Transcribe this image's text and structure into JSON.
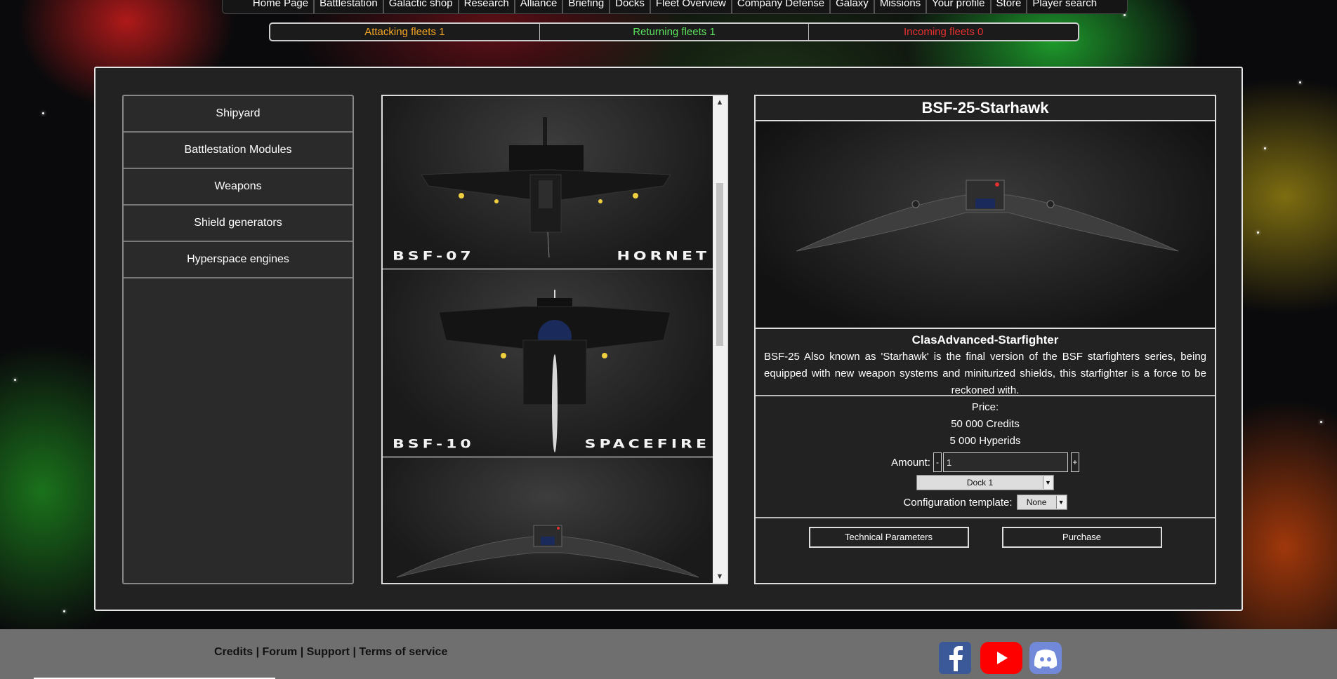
{
  "nav": {
    "items": [
      "Home Page",
      "Battlestation",
      "Galactic shop",
      "Research",
      "Alliance",
      "Briefing",
      "Docks",
      "Fleet Overview",
      "Company Defense",
      "Galaxy",
      "Missions",
      "Your profile",
      "Store",
      "Player search"
    ]
  },
  "fleets": {
    "attacking": "Attacking fleets 1",
    "returning": "Returning fleets 1",
    "incoming": "Incoming fleets 0",
    "colors": {
      "attacking": "#f5a623",
      "returning": "#5be35b",
      "incoming": "#e8312f"
    }
  },
  "menu": {
    "items": [
      "Shipyard",
      "Battlestation Modules",
      "Weapons",
      "Shield generators",
      "Hyperspace engines"
    ]
  },
  "ships": [
    {
      "code": "BSF-07",
      "name": "HORNET"
    },
    {
      "code": "BSF-10",
      "name": "SPACEFIRE"
    },
    {
      "code": "",
      "name": ""
    }
  ],
  "detail": {
    "title": "BSF-25-Starhawk",
    "class": "ClasAdvanced-Starfighter",
    "description": "BSF-25 Also known as 'Starhawk' is the final version of the BSF starfighters series, being equipped with new weapon systems and miniturized shields, this starfighter is a force to be reckoned with.",
    "price_label": "Price:",
    "price_credits": "50 000 Credits",
    "price_hyperids": "5 000 Hyperids",
    "amount_label": "Amount:",
    "amount_value": "1",
    "minus": "-",
    "plus": "+",
    "dock_selected": "Dock 1",
    "template_label": "Configuration template:",
    "template_selected": "None",
    "technical_button": "Technical Parameters",
    "purchase_button": "Purchase"
  },
  "footer": {
    "credits": "Credits",
    "forum": "Forum",
    "support": "Support",
    "terms": "Terms of service",
    "separator": "|"
  }
}
